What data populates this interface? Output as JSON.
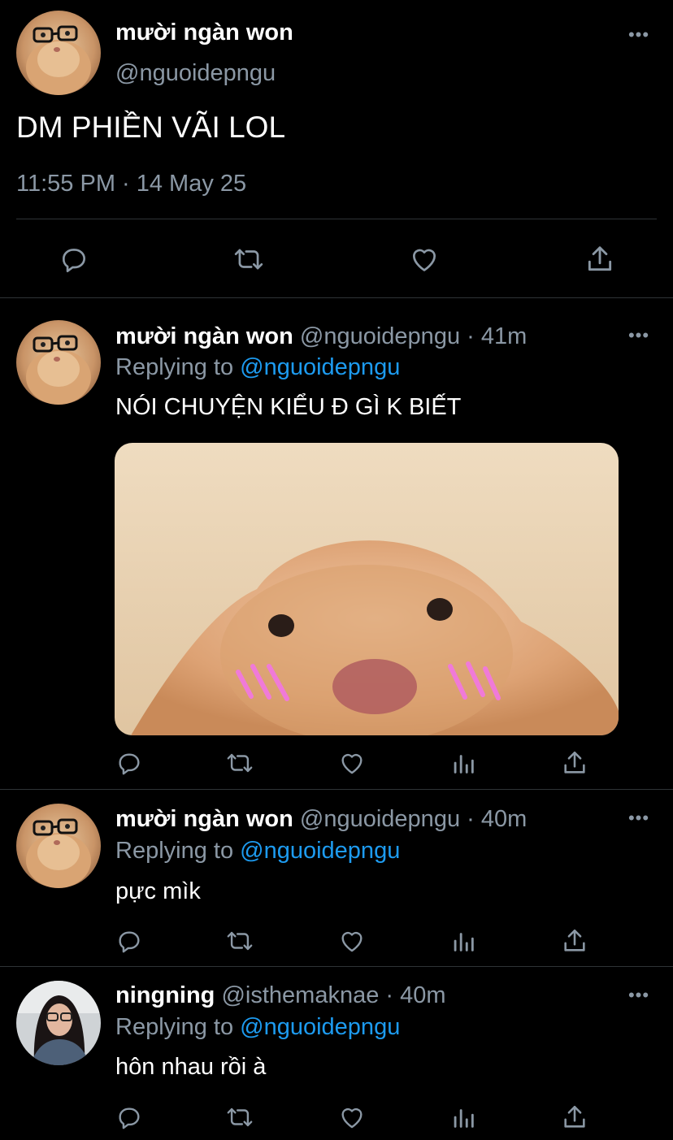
{
  "main_tweet": {
    "name": "mười ngàn won",
    "handle": "@nguoidepngu",
    "text": "DM PHIỀN VÃI LOL",
    "timestamp": "11:55 PM · 14 May 25",
    "avatar_icon": "hamster-glasses-avatar",
    "actions": [
      "reply-icon",
      "retweet-icon",
      "like-icon",
      "share-icon"
    ]
  },
  "replies": [
    {
      "name": "mười ngàn won",
      "meta": "@nguoidepngu · 41m",
      "replying_prefix": "Replying to",
      "replying_to": "@nguoidepngu",
      "text": "NÓI CHUYỆN KIỂU Đ GÌ K BIẾT",
      "media": "hamster-blushing-photo",
      "avatar_icon": "hamster-glasses-avatar"
    },
    {
      "name": "mười ngàn won",
      "meta": "@nguoidepngu · 40m",
      "replying_prefix": "Replying to",
      "replying_to": "@nguoidepngu",
      "text": "pực mìk",
      "avatar_icon": "hamster-glasses-avatar"
    },
    {
      "name": "ningning",
      "meta": "@isthemaknae · 40m",
      "replying_prefix": "Replying to",
      "replying_to": "@nguoidepngu",
      "text": "hôn nhau rồi à",
      "avatar_icon": "person-avatar"
    }
  ],
  "colors": {
    "background": "#000000",
    "text": "#ffffff",
    "secondary": "#8b98a5",
    "link": "#1d9bf0",
    "divider": "#2f3336",
    "blush": "#f07ad8"
  }
}
